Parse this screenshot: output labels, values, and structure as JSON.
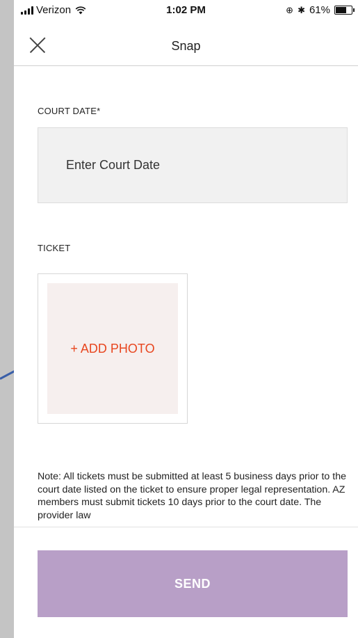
{
  "status_bar": {
    "carrier": "Verizon",
    "time": "1:02 PM",
    "battery_percent": "61%",
    "battery_level": 0.61
  },
  "nav": {
    "title": "Snap",
    "close_icon": "close-icon"
  },
  "form": {
    "court_date_label": "COURT DATE*",
    "court_date_placeholder": "Enter Court Date",
    "ticket_label": "TICKET",
    "add_photo_label": "+ ADD PHOTO",
    "note": "Note: All tickets must be submitted at least 5 business days prior to the court date listed on the ticket to ensure proper legal representation. AZ members must submit tickets 10 days prior to the court date. The provider law"
  },
  "actions": {
    "send_label": "SEND"
  },
  "colors": {
    "accent_orange": "#e8461f",
    "send_button": "#b89fc7",
    "input_bg": "#f1f1f1",
    "photo_bg": "#f6efee"
  }
}
